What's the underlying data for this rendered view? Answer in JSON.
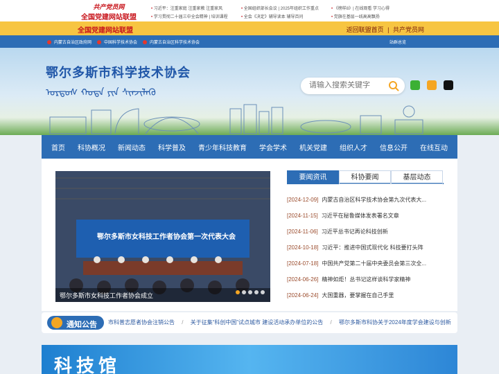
{
  "topbar": {
    "logo_line1": "共产党员网",
    "logo_line2": "全国党建网站联盟",
    "links": [
      "习近平：注重家庭 注重家教 注重家风",
      "全国组织部长会议 | 2025年组织工作重点",
      "《榜样8》| 在线观看 学习心得",
      "学习贯彻二十届三中全会精神 | 培训课程",
      "全会《决定》辅导读本  辅导百问",
      "党旗在基层一线高高飘扬"
    ]
  },
  "yellowbar": {
    "title": "全国党建网站联盟",
    "return_link": "返回联盟首页",
    "sep": "|",
    "member_link": "共产党员网"
  },
  "subbar": {
    "links": [
      "内蒙古自治区政府网",
      "中国科学技术协会",
      "内蒙古自治区科学技术协会"
    ],
    "site_group": "站群总览"
  },
  "banner": {
    "title": "鄂尔多斯市科学技术协会",
    "mongolian": "ᠣᠷᠳᠣᠰ ᠬᠣᠲᠠ ᠶᠢᠨ ᠱᠢᠨᠵᠢᠯᠡᠬᠦ",
    "search_placeholder": "请输入搜索关键字",
    "social_colors": {
      "wechat": "#3cb034",
      "weibo": "#f5a623",
      "tiktok": "#111111"
    }
  },
  "nav": {
    "items": [
      "首页",
      "科协概况",
      "新闻动态",
      "科学普及",
      "青少年科技教育",
      "学会学术",
      "机关党建",
      "组织人才",
      "信息公开",
      "在线互动"
    ]
  },
  "slide": {
    "screen_text": "鄂尔多斯市女科技工作者协会第一次代表大会",
    "caption": "鄂尔多斯市女科技工作者协会成立",
    "slide_count": 5,
    "active_index": 0
  },
  "tabs": {
    "items": [
      "要闻资讯",
      "科协要闻",
      "基层动态"
    ],
    "active": 0
  },
  "news": [
    {
      "date": "[2024-12-09]",
      "title": "内蒙古自治区科学技术协会第九次代表大..."
    },
    {
      "date": "[2024-11-15]",
      "title": "习近平在秘鲁媒体发表署名文章"
    },
    {
      "date": "[2024-11-06]",
      "title": "习近平总书记再论科技创新"
    },
    {
      "date": "[2024-10-18]",
      "title": "习近平：推进中国式现代化 科技要打头阵"
    },
    {
      "date": "[2024-07-18]",
      "title": "中国共产党第二十届中央委员会第三次全..."
    },
    {
      "date": "[2024-06-26]",
      "title": "精神如炬！总书记这样谈科学家精神"
    },
    {
      "date": "[2024-06-24]",
      "title": "大国重器，要掌握在自己手里"
    }
  ],
  "notice": {
    "label": "通知公告",
    "items": [
      "市科普志愿者协会注销公告",
      "关于征集“科创中国”试点城市 建设活动承办单位的公告",
      "鄂尔多斯市科协关于2024年度学会建设与创新"
    ],
    "sep": "/"
  },
  "bottom": {
    "title": "科技馆"
  }
}
